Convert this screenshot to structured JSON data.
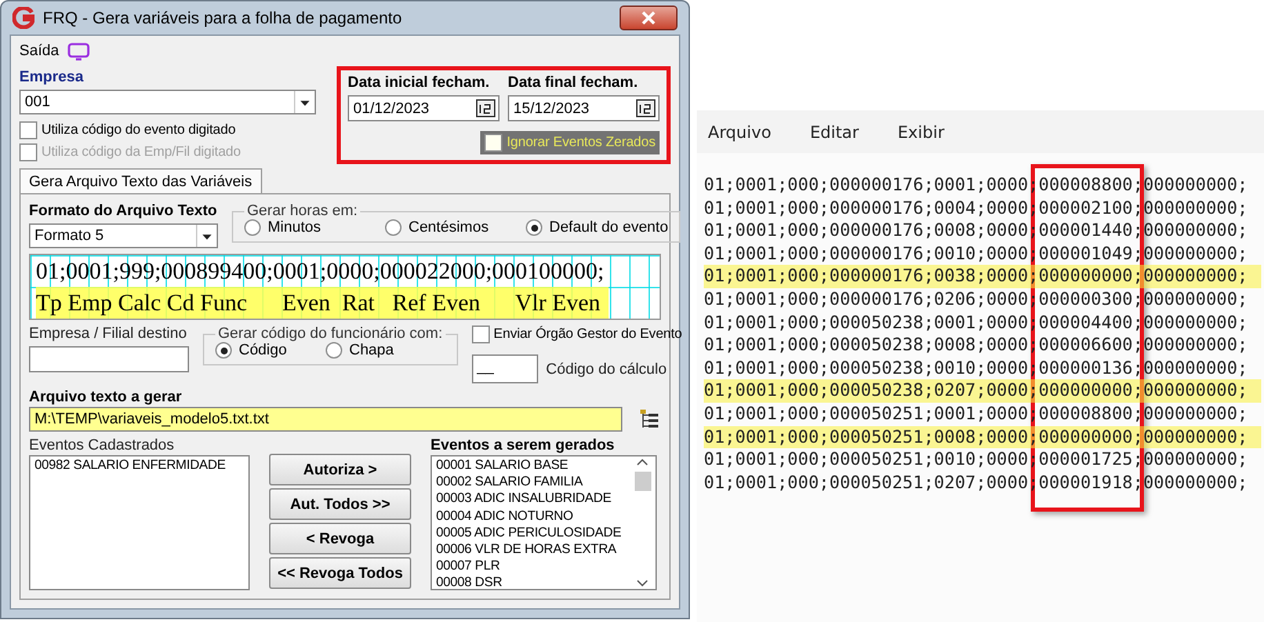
{
  "window": {
    "title": "FRQ - Gera variáveis para a folha de pagamento"
  },
  "menu": [
    {
      "label": "Saída"
    }
  ],
  "empresa": {
    "label": "Empresa",
    "value": "001"
  },
  "options": [
    {
      "label": "Utiliza código do evento digitado",
      "checked": false,
      "disabled": false
    },
    {
      "label": "Utiliza código da Emp/Fil digitado",
      "checked": false,
      "disabled": true
    }
  ],
  "dates": [
    {
      "label": "Data inicial fecham.",
      "value": "01/12/2023"
    },
    {
      "label": "Data final fecham.",
      "value": "15/12/2023"
    }
  ],
  "ignore_zero": {
    "label": "Ignorar Eventos Zerados",
    "checked": false
  },
  "tabs": [
    {
      "label": "Gera Arquivo Texto das Variáveis",
      "selected": true
    }
  ],
  "format": {
    "label": "Formato do Arquivo Texto",
    "value": "Formato 5"
  },
  "hours": {
    "title": "Gerar horas em:",
    "options": [
      {
        "label": "Minutos",
        "selected": false
      },
      {
        "label": "Centésimos",
        "selected": false
      },
      {
        "label": "Default do evento",
        "selected": true
      }
    ]
  },
  "preview": {
    "lines": [
      "01;0001;999;000899400;0001;0000;000022000;000100000;",
      "Tp Emp Calc Cd Func      Even  Rat   Ref Even      Vlr Even"
    ]
  },
  "destination": {
    "label": "Empresa / Filial destino"
  },
  "employee_code": {
    "title": "Gerar código do funcionário com:",
    "options": [
      {
        "label": "Código",
        "selected": true
      },
      {
        "label": "Chapa",
        "selected": false
      }
    ]
  },
  "send_gestor": {
    "label": "Enviar Órgão Gestor do Evento",
    "checked": false
  },
  "calc_code": {
    "label": "Código do cálculo",
    "value": "__"
  },
  "output_file": {
    "label": "Arquivo texto a gerar",
    "value": "M:\\TEMP\\variaveis_modelo5.txt.txt"
  },
  "registered_events": {
    "label": "Eventos Cadastrados",
    "items": [
      "00982 SALARIO ENFERMIDADE"
    ]
  },
  "buttons": [
    "Autoriza >",
    "Aut. Todos >>",
    "< Revoga",
    "<< Revoga Todos"
  ],
  "selected_events": {
    "label": "Eventos a serem gerados",
    "items": [
      "00001 SALARIO BASE",
      "00002 SALARIO FAMILIA",
      "00003 ADIC INSALUBRIDADE",
      "00004 ADIC NOTURNO",
      "00005 ADIC PERICULOSIDADE",
      "00006 VLR DE HORAS EXTRA",
      "00007 PLR",
      "00008 DSR"
    ]
  },
  "notepad": {
    "menu": [
      "Arquivo",
      "Editar",
      "Exibir"
    ],
    "lines": [
      {
        "text": "01;0001;000;000000176;0001;0000;000008800;000000000;",
        "highlighted": false
      },
      {
        "text": "01;0001;000;000000176;0004;0000;000002100;000000000;",
        "highlighted": false
      },
      {
        "text": "01;0001;000;000000176;0008;0000;000001440;000000000;",
        "highlighted": false
      },
      {
        "text": "01;0001;000;000000176;0010;0000;000001049;000000000;",
        "highlighted": false
      },
      {
        "text": "01;0001;000;000000176;0038;0000;000000000;000000000;",
        "highlighted": true
      },
      {
        "text": "01;0001;000;000000176;0206;0000;000000300;000000000;",
        "highlighted": false
      },
      {
        "text": "01;0001;000;000050238;0001;0000;000004400;000000000;",
        "highlighted": false
      },
      {
        "text": "01;0001;000;000050238;0008;0000;000006600;000000000;",
        "highlighted": false
      },
      {
        "text": "01;0001;000;000050238;0010;0000;000000136;000000000;",
        "highlighted": false
      },
      {
        "text": "01;0001;000;000050238;0207;0000;000000000;000000000;",
        "highlighted": true
      },
      {
        "text": "01;0001;000;000050251;0001;0000;000008800;000000000;",
        "highlighted": false
      },
      {
        "text": "01;0001;000;000050251;0008;0000;000000000;000000000;",
        "highlighted": true
      },
      {
        "text": "01;0001;000;000050251;0010;0000;000001725;000000000;",
        "highlighted": false
      },
      {
        "text": "01;0001;000;000050251;0207;0000;000001918;000000000;",
        "highlighted": false
      }
    ]
  }
}
